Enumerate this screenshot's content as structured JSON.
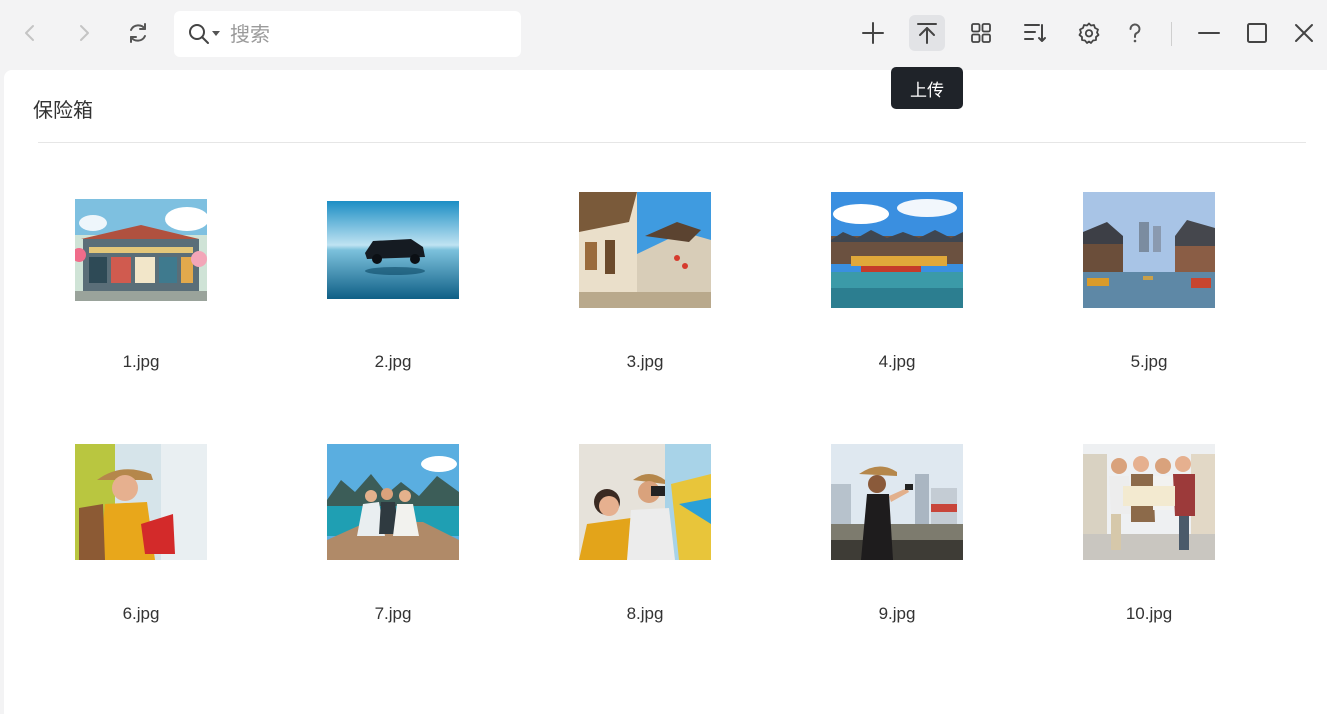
{
  "toolbar": {
    "search_placeholder": "搜索",
    "upload_tooltip": "上传"
  },
  "vault": {
    "title": "保险箱"
  },
  "files": [
    {
      "name": "1.jpg"
    },
    {
      "name": "2.jpg"
    },
    {
      "name": "3.jpg"
    },
    {
      "name": "4.jpg"
    },
    {
      "name": "5.jpg"
    },
    {
      "name": "6.jpg"
    },
    {
      "name": "7.jpg"
    },
    {
      "name": "8.jpg"
    },
    {
      "name": "9.jpg"
    },
    {
      "name": "10.jpg"
    }
  ],
  "icons": {
    "back": "chevron-left-icon",
    "forward": "chevron-right-icon",
    "refresh": "refresh-icon",
    "search": "search-icon",
    "new": "plus-icon",
    "upload": "upload-icon",
    "view": "grid-view-icon",
    "sort": "sort-icon",
    "settings": "gear-icon",
    "help": "question-icon",
    "minimize": "minimize-icon",
    "maximize": "maximize-icon",
    "close": "close-icon"
  },
  "colors": {
    "background": "#f3f3f4",
    "panel": "#ffffff",
    "tooltip": "#1f2329",
    "active_tool": "#e2e3e6"
  }
}
